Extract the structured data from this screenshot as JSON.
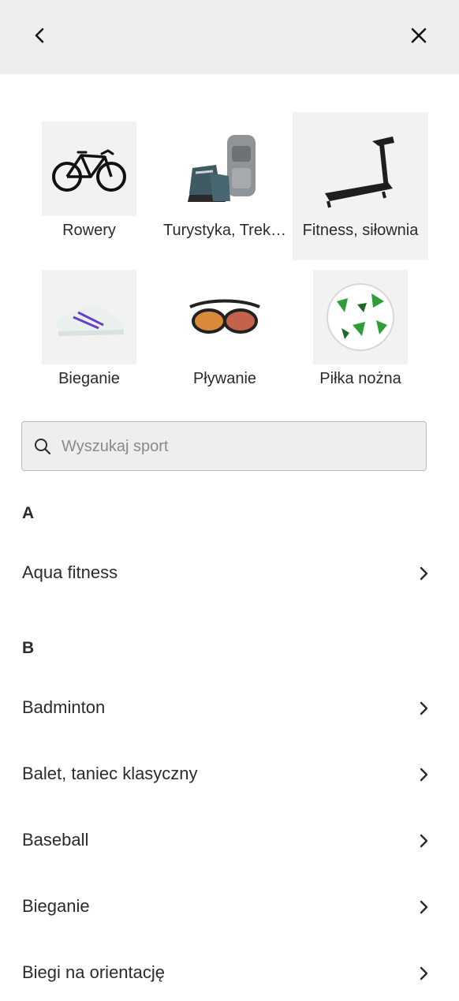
{
  "header": {
    "back_icon": "chevron-left-icon",
    "close_icon": "close-icon"
  },
  "tiles": [
    {
      "label": "Rowery",
      "icon": "bicycle-image"
    },
    {
      "label": "Turystyka, Trek…",
      "icon": "hiking-gear-image"
    },
    {
      "label": "Fitness, siłownia",
      "icon": "treadmill-image",
      "selected": true
    },
    {
      "label": "Bieganie",
      "icon": "running-shoe-image"
    },
    {
      "label": "Pływanie",
      "icon": "swim-goggles-image"
    },
    {
      "label": "Piłka nożna",
      "icon": "soccer-ball-image"
    }
  ],
  "search": {
    "placeholder": "Wyszukaj sport",
    "icon": "search-icon"
  },
  "sections": [
    {
      "letter": "A",
      "items": [
        "Aqua fitness"
      ]
    },
    {
      "letter": "B",
      "items": [
        "Badminton",
        "Balet, taniec klasyczny",
        "Baseball",
        "Bieganie",
        "Biegi na orientację"
      ]
    }
  ],
  "colors": {
    "header_bg": "#efeeec",
    "selected_tile_bg": "#f3f2f1",
    "text": "#2b2b2b",
    "shoe_accent": "#6a3fc4",
    "ball_accent": "#2f9e3a"
  }
}
